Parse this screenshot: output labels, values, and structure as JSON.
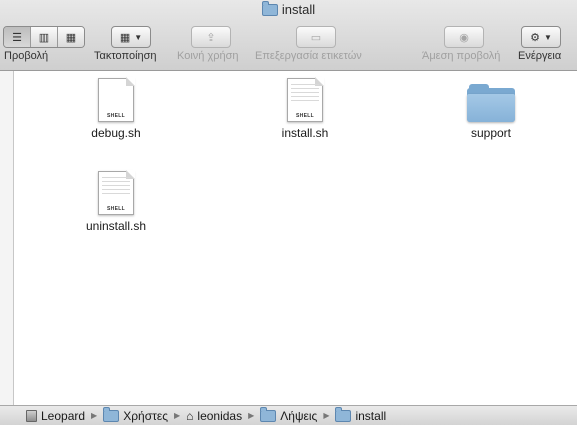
{
  "window": {
    "title": "install"
  },
  "toolbar": {
    "view_label": "Προβολή",
    "arrange_label": "Τακτοποίηση",
    "share_label": "Κοινή χρήση",
    "tags_label": "Επεξεργασία ετικετών",
    "quicklook_label": "Άμεση προβολή",
    "action_label": "Ενέργεια",
    "view_modes": [
      "list-icon",
      "columns-icon",
      "coverflow-icon"
    ]
  },
  "items": [
    {
      "name": "debug.sh",
      "kind": "shell-file-icon",
      "badge": "SHELL"
    },
    {
      "name": "install.sh",
      "kind": "shell-file-icon",
      "badge": "SHELL"
    },
    {
      "name": "support",
      "kind": "folder-icon"
    },
    {
      "name": "uninstall.sh",
      "kind": "shell-file-icon",
      "badge": "SHELL"
    }
  ],
  "pathbar": {
    "crumbs": [
      "Leopard",
      "Χρήστες",
      "leonidas",
      "Λήψεις",
      "install"
    ]
  }
}
